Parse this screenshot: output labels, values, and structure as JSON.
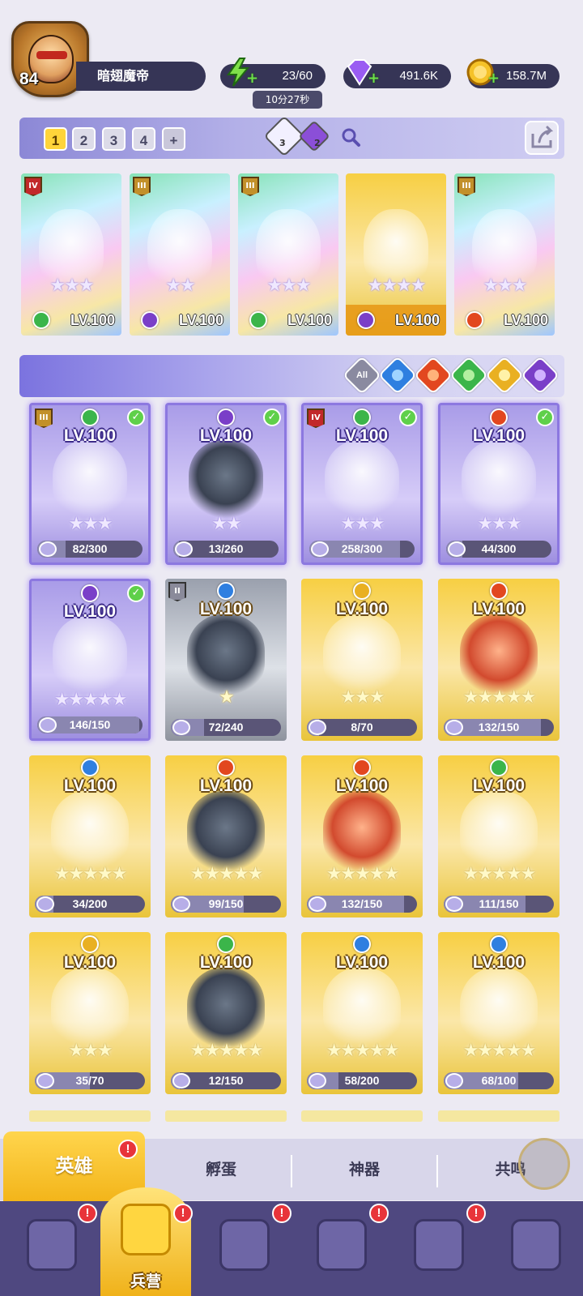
{
  "player": {
    "level": "84",
    "name": "暗翅魔帝"
  },
  "resources": {
    "energy": "23/60",
    "energy_timer": "10分27秒",
    "gems": "491.6K",
    "gold": "158.7M"
  },
  "team_bar": {
    "teams": [
      "1",
      "2",
      "3",
      "4"
    ],
    "active_team": "1",
    "add_label": "+",
    "buff_a_count": "3",
    "buff_b_count": "2"
  },
  "team_slots": [
    {
      "rank": "IV",
      "stars": "★★★",
      "level": "LV.100",
      "element": "wind"
    },
    {
      "rank": "III",
      "stars": "★★",
      "level": "LV.100",
      "element": "dark"
    },
    {
      "rank": "III",
      "stars": "★★★",
      "level": "LV.100",
      "element": "wind"
    },
    {
      "rank": "",
      "stars": "★★★★",
      "level": "LV.100",
      "element": "dark"
    },
    {
      "rank": "III",
      "stars": "★★★",
      "level": "LV.100",
      "element": "fire"
    }
  ],
  "filter": {
    "all_label": "All",
    "elements": [
      "water",
      "fire",
      "wind",
      "light",
      "dark"
    ]
  },
  "heroes": [
    {
      "level": "LV.100",
      "rank": "III",
      "element": "wind",
      "stars": "★★★",
      "shards": "82/300",
      "fill": 0.27,
      "in_team": true
    },
    {
      "level": "LV.100",
      "rank": "",
      "element": "dark",
      "stars": "★★",
      "shards": "13/260",
      "fill": 0.05,
      "in_team": true
    },
    {
      "level": "LV.100",
      "rank": "IV",
      "element": "wind",
      "stars": "★★★",
      "shards": "258/300",
      "fill": 0.86,
      "in_team": true
    },
    {
      "level": "LV.100",
      "rank": "",
      "element": "fire",
      "stars": "★★★",
      "shards": "44/300",
      "fill": 0.15,
      "in_team": true
    },
    {
      "level": "LV.100",
      "rank": "",
      "element": "dark",
      "stars": "★★★★★",
      "shards": "146/150",
      "fill": 0.97,
      "in_team": true
    },
    {
      "level": "LV.100",
      "rank": "II",
      "element": "water",
      "stars": "★",
      "shards": "72/240",
      "fill": 0.3,
      "in_team": false
    },
    {
      "level": "LV.100",
      "rank": "",
      "element": "light",
      "stars": "★★★",
      "shards": "8/70",
      "fill": 0.11,
      "in_team": false
    },
    {
      "level": "LV.100",
      "rank": "",
      "element": "fire",
      "stars": "★★★★★",
      "shards": "132/150",
      "fill": 0.88,
      "in_team": false
    },
    {
      "level": "LV.100",
      "rank": "",
      "element": "water",
      "stars": "★★★★★",
      "shards": "34/200",
      "fill": 0.17,
      "in_team": false
    },
    {
      "level": "LV.100",
      "rank": "",
      "element": "fire",
      "stars": "★★★★★",
      "shards": "99/150",
      "fill": 0.66,
      "in_team": false
    },
    {
      "level": "LV.100",
      "rank": "",
      "element": "fire",
      "stars": "★★★★★",
      "shards": "132/150",
      "fill": 0.88,
      "in_team": false
    },
    {
      "level": "LV.100",
      "rank": "",
      "element": "wind",
      "stars": "★★★★★",
      "shards": "111/150",
      "fill": 0.74,
      "in_team": false
    },
    {
      "level": "LV.100",
      "rank": "",
      "element": "light",
      "stars": "★★★",
      "shards": "35/70",
      "fill": 0.5,
      "in_team": false
    },
    {
      "level": "LV.100",
      "rank": "",
      "element": "wind",
      "stars": "★★★★★",
      "shards": "12/150",
      "fill": 0.08,
      "in_team": false
    },
    {
      "level": "LV.100",
      "rank": "",
      "element": "water",
      "stars": "★★★★★",
      "shards": "58/200",
      "fill": 0.29,
      "in_team": false
    },
    {
      "level": "LV.100",
      "rank": "",
      "element": "water",
      "stars": "★★★★★",
      "shards": "68/100",
      "fill": 0.68,
      "in_team": false
    }
  ],
  "sub_tabs": {
    "heroes": "英雄",
    "hatch": "孵蛋",
    "artifact": "神器",
    "resonance": "共鸣"
  },
  "nav": {
    "barracks_label": "兵营",
    "alert": "!"
  },
  "colors": {
    "accent_gold": "#f7cf43",
    "element_wind": "#3bb54a",
    "element_dark": "#7a3fc8",
    "element_fire": "#e2471f",
    "element_water": "#2f7fe0",
    "element_light": "#e9b022"
  }
}
